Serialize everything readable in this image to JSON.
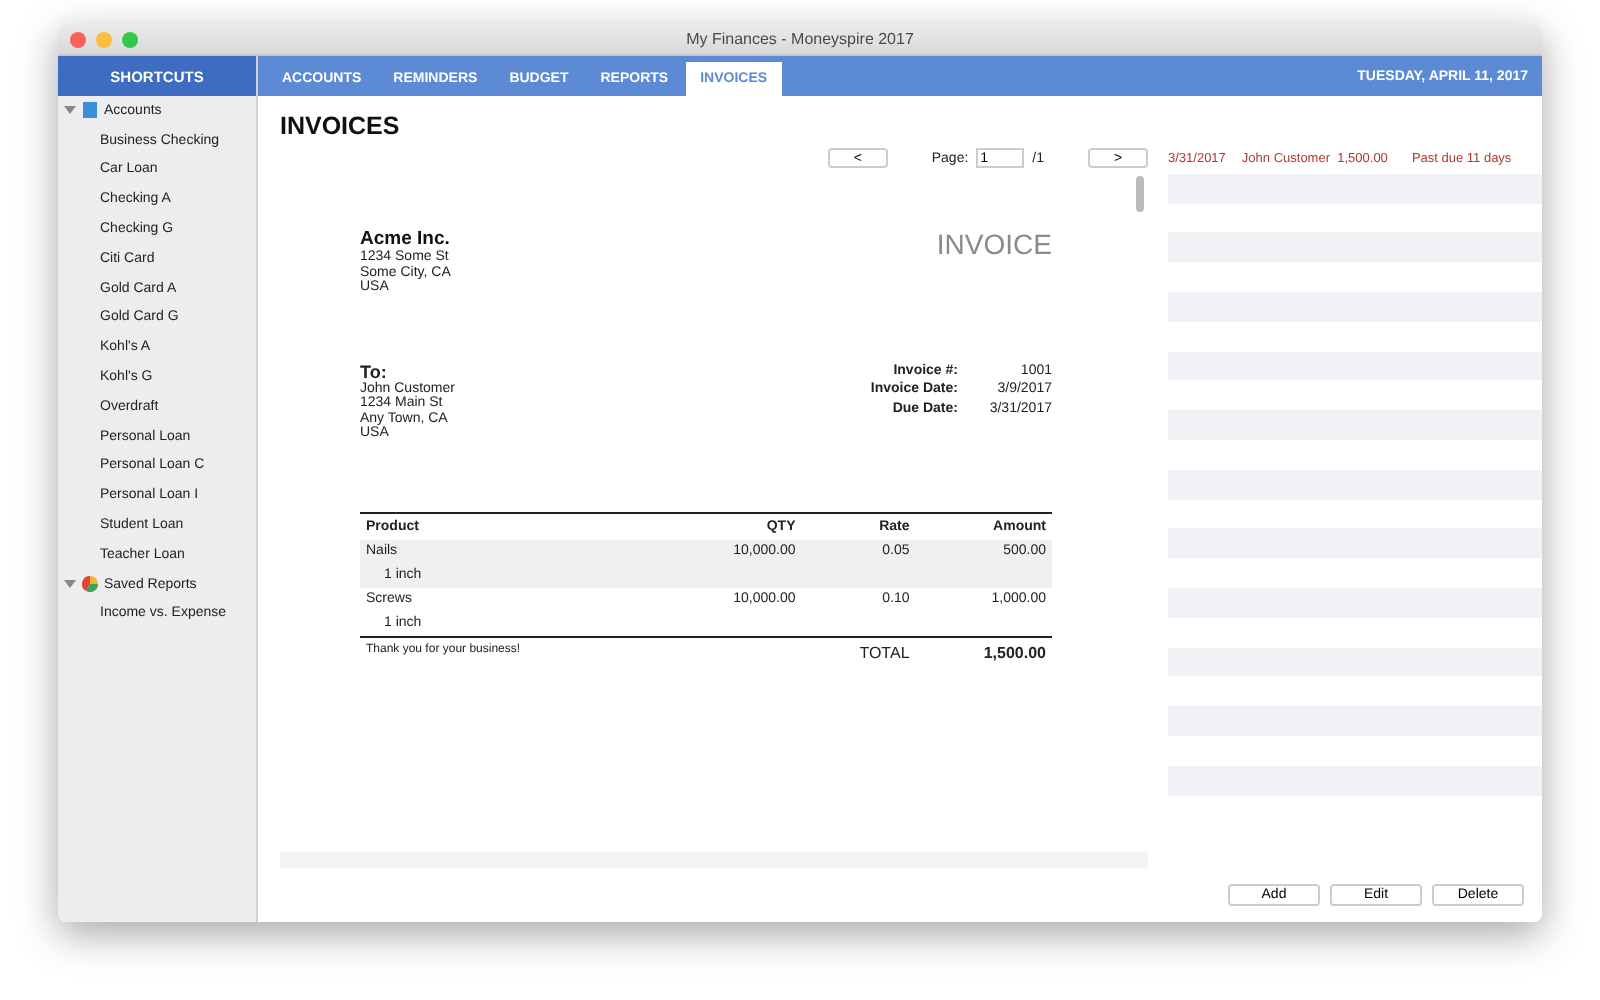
{
  "window": {
    "title": "My Finances - Moneyspire 2017"
  },
  "sidebar": {
    "header": "SHORTCUTS",
    "groups": [
      {
        "label": "Accounts",
        "kind": "accounts",
        "expanded": true,
        "children": [
          {
            "label": "Business Checking"
          },
          {
            "label": "Car Loan"
          },
          {
            "label": "Checking A"
          },
          {
            "label": "Checking G"
          },
          {
            "label": "Citi Card"
          },
          {
            "label": "Gold Card A"
          },
          {
            "label": "Gold Card G"
          },
          {
            "label": "Kohl's A"
          },
          {
            "label": "Kohl's G"
          },
          {
            "label": "Overdraft"
          },
          {
            "label": "Personal Loan"
          },
          {
            "label": "Personal Loan C"
          },
          {
            "label": "Personal Loan I"
          },
          {
            "label": "Student Loan"
          },
          {
            "label": "Teacher Loan"
          }
        ]
      },
      {
        "label": "Saved Reports",
        "kind": "reports",
        "expanded": true,
        "children": [
          {
            "label": "Income vs. Expense"
          }
        ]
      }
    ]
  },
  "tabs": [
    {
      "label": "ACCOUNTS",
      "selected": false
    },
    {
      "label": "REMINDERS",
      "selected": false
    },
    {
      "label": "BUDGET",
      "selected": false
    },
    {
      "label": "REPORTS",
      "selected": false
    },
    {
      "label": "INVOICES",
      "selected": true
    }
  ],
  "date": "TUESDAY, APRIL 11, 2017",
  "page_title": "INVOICES",
  "pager": {
    "prev": "<",
    "label": "Page:",
    "value": "1",
    "total": "/1",
    "next": ">"
  },
  "invoice": {
    "company": "Acme Inc.",
    "company_address": [
      "1234 Some St",
      "Some City, CA",
      "USA"
    ],
    "heading": "INVOICE",
    "to_label": "To:",
    "to_address": [
      "John Customer",
      "1234 Main St",
      "Any Town, CA",
      "USA"
    ],
    "meta": [
      {
        "label": "Invoice #:",
        "value": "1001"
      },
      {
        "label": "Invoice Date:",
        "value": "3/9/2017"
      },
      {
        "label": "Due Date:",
        "value": "3/31/2017"
      }
    ],
    "columns": [
      "Product",
      "QTY",
      "Rate",
      "Amount"
    ],
    "items": [
      {
        "product": "Nails",
        "detail": "1 inch",
        "qty": "10,000.00",
        "rate": "0.05",
        "amount": "500.00"
      },
      {
        "product": "Screws",
        "detail": "1 inch",
        "qty": "10,000.00",
        "rate": "0.10",
        "amount": "1,000.00"
      }
    ],
    "note": "Thank you for your business!",
    "total_label": "TOTAL",
    "total": "1,500.00"
  },
  "invoice_list": [
    {
      "date": "3/31/2017",
      "customer": "John Customer",
      "amount": "1,500.00",
      "status": "Past due 11 days",
      "overdue": true
    }
  ],
  "buttons": [
    "Add",
    "Edit",
    "Delete"
  ]
}
